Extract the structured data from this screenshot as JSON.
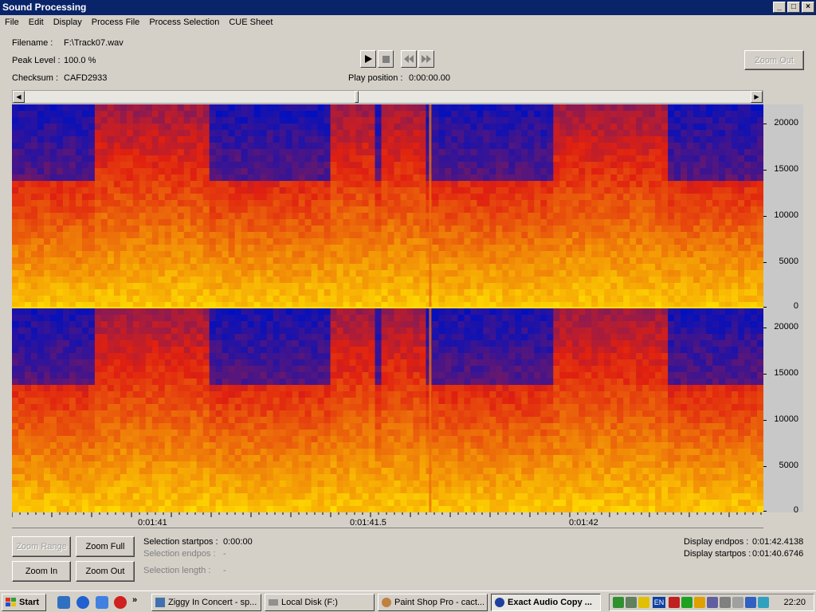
{
  "window": {
    "title": "Sound Processing",
    "controls": [
      "_",
      "□",
      "×"
    ]
  },
  "menu": [
    "File",
    "Edit",
    "Display",
    "Process File",
    "Process Selection",
    "CUE Sheet"
  ],
  "info": {
    "filename_label": "Filename :",
    "filename_value": "F:\\Track07.wav",
    "peak_label": "Peak Level :",
    "peak_value": "100.0 %",
    "checksum_label": "Checksum :",
    "checksum_value": "CAFD2933"
  },
  "transport": {
    "play_position_label": "Play position :",
    "play_position_value": "0:00:00.00",
    "play_icon": "play-icon",
    "stop_icon": "stop-icon",
    "rewind_icon": "rewind-icon",
    "forward_icon": "forward-icon"
  },
  "zoom_out_top_label": "Zoom Out",
  "frequency_axis": {
    "ticks": [
      "20000",
      "15000",
      "10000",
      "5000",
      "0"
    ]
  },
  "time_axis": {
    "labels": [
      "0:01:41",
      "0:01:41.5",
      "0:01:42"
    ]
  },
  "buttons": {
    "zoom_range": "Zoom Range",
    "zoom_full": "Zoom Full",
    "zoom_in": "Zoom In",
    "zoom_out": "Zoom Out"
  },
  "selection": {
    "startpos_label": "Selection startpos :",
    "startpos_value": "0:00:00",
    "endpos_label": "Selection endpos :",
    "endpos_value": "-",
    "length_label": "Selection length :",
    "length_value": "-"
  },
  "display": {
    "endpos_label": "Display endpos :",
    "endpos_value": "0:01:42.4138",
    "startpos_label": "Display startpos :",
    "startpos_value": "0:01:40.6746"
  },
  "taskbar": {
    "start_label": "Start",
    "tasks": [
      "Ziggy In Concert - sp...",
      "Local Disk (F:)",
      "Paint Shop Pro - cact...",
      "Exact Audio Copy ..."
    ],
    "language": "EN",
    "clock": "22:20"
  },
  "colors": {
    "title_bar": "#0a246a",
    "spectrum_low": "#0010c0",
    "spectrum_mid": "#e02010",
    "spectrum_high": "#ffe000"
  }
}
